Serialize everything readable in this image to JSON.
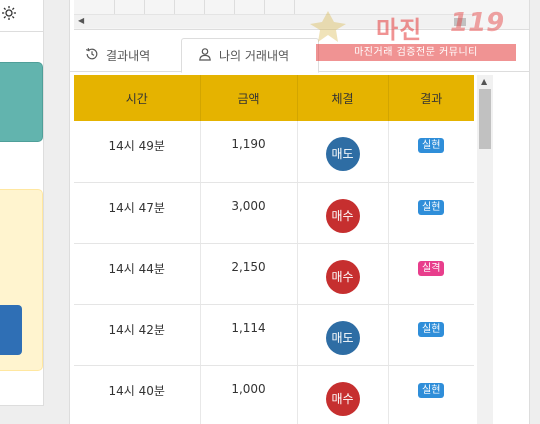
{
  "tabs": {
    "result_history": "결과내역",
    "my_trades": "나의 거래내역"
  },
  "watermark": {
    "title": "마진",
    "number": "119",
    "tagline": "마진거래 검증전문 커뮤니티"
  },
  "table": {
    "headers": [
      "시간",
      "금액",
      "체결",
      "결과"
    ],
    "rows": [
      {
        "time": "14시 49분",
        "amount": "1,190",
        "action": "매도",
        "result": "실현"
      },
      {
        "time": "14시 47분",
        "amount": "3,000",
        "action": "매수",
        "result": "실현"
      },
      {
        "time": "14시 44분",
        "amount": "2,150",
        "action": "매수",
        "result": "실격"
      },
      {
        "time": "14시 42분",
        "amount": "1,114",
        "action": "매도",
        "result": "실현"
      },
      {
        "time": "14시 40분",
        "amount": "1,000",
        "action": "매수",
        "result": "실현"
      }
    ]
  },
  "colors": {
    "header_bg": "#e5b300",
    "sell": "#2e6da4",
    "buy": "#c62f2f",
    "realized": "#2f8ed9",
    "failed": "#e83e8c"
  },
  "icons": {
    "settings": "gear-icon",
    "history": "history-icon",
    "user": "user-icon"
  }
}
